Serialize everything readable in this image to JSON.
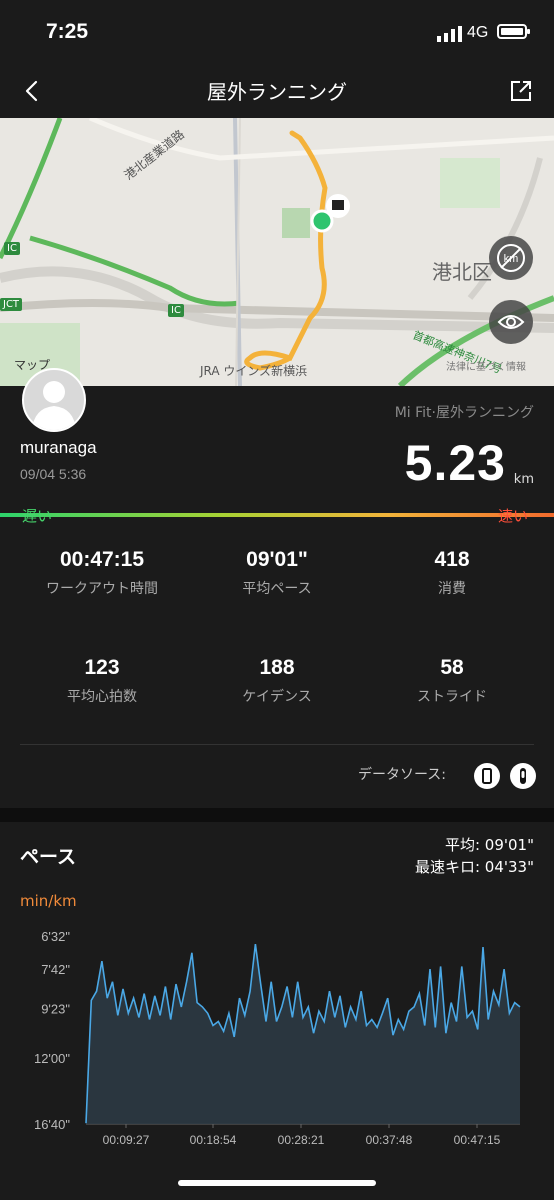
{
  "status": {
    "time": "7:25",
    "network": "4G"
  },
  "nav": {
    "title": "屋外ランニング"
  },
  "map": {
    "labels": [
      "港北産業道路",
      "IC",
      "JCT",
      "IC",
      "港北区",
      "首都高速神奈川7号",
      "JRA ウインズ新横浜",
      "法律に基づく情報",
      "マップ"
    ],
    "buttons": [
      "km-toggle",
      "eye-toggle"
    ]
  },
  "profile": {
    "source": "Mi Fit·屋外ランニング",
    "username": "muranaga",
    "datetime": "09/04 5:36",
    "distance": "5.23",
    "unit": "km"
  },
  "pace_bar": {
    "slow": "遅い",
    "fast": "速い"
  },
  "stats": [
    {
      "value": "00:47:15",
      "label": "ワークアウト時間"
    },
    {
      "value": "09'01\"",
      "label": "平均ペース"
    },
    {
      "value": "418",
      "label": "消費"
    },
    {
      "value": "123",
      "label": "平均心拍数"
    },
    {
      "value": "188",
      "label": "ケイデンス"
    },
    {
      "value": "58",
      "label": "ストライド"
    }
  ],
  "data_source": {
    "label": "データソース:"
  },
  "pace": {
    "title": "ペース",
    "avg": "平均: 09'01\"",
    "fastest": "最速キロ: 04'33\"",
    "unit_label": "min/km"
  },
  "chart_data": {
    "type": "area",
    "y_ticks": [
      "6'32\"",
      "7'42\"",
      "9'23\"",
      "12'00\"",
      "16'40\""
    ],
    "x_ticks": [
      "00:09:27",
      "00:18:54",
      "00:28:21",
      "00:37:48",
      "00:47:15"
    ],
    "ylim": [
      "16'40\"",
      "6'32\""
    ],
    "series": [
      {
        "values": [
          16.6,
          9.0,
          8.6,
          7.4,
          8.9,
          8.2,
          9.7,
          8.5,
          9.6,
          8.9,
          9.8,
          8.7,
          9.9,
          8.8,
          9.7,
          8.4,
          9.9,
          8.3,
          9.3,
          8.2,
          7.1,
          9.1,
          9.3,
          9.6,
          10.2,
          10.0,
          10.5,
          9.6,
          10.8,
          8.9,
          9.7,
          8.6,
          6.8,
          8.3,
          10.0,
          8.2,
          10.0,
          9.3,
          8.4,
          9.8,
          8.2,
          9.8,
          9.3,
          10.6,
          9.5,
          10.0,
          8.6,
          9.8,
          8.8,
          10.3,
          9.3,
          9.9,
          8.6,
          10.2,
          9.9,
          10.3,
          9.6,
          8.9,
          10.7,
          9.9,
          10.4,
          9.5,
          9.3,
          8.7,
          10.2,
          7.7,
          10.3,
          7.6,
          10.6,
          9.1,
          10.0,
          7.6,
          9.8,
          9.5,
          10.4,
          6.9,
          9.9,
          8.6,
          9.2,
          7.7,
          9.6,
          9.1,
          9.3
        ]
      }
    ],
    "colors": {
      "line": "#4aa8e6",
      "fill": "#2c3a44"
    }
  }
}
